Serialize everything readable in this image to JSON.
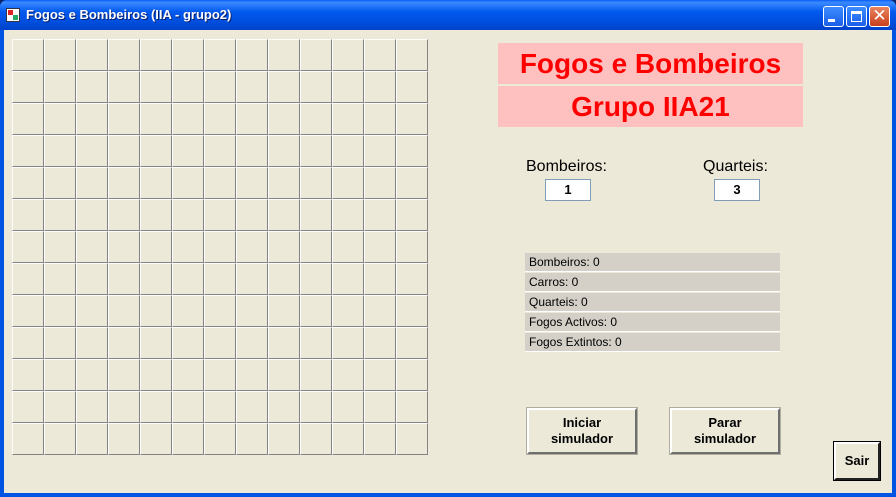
{
  "window": {
    "title": "Fogos e Bombeiros (IIA - grupo2)"
  },
  "grid": {
    "rows": 13,
    "columns": 13
  },
  "banner": {
    "line1": "Fogos e Bombeiros",
    "line2": "Grupo IIA21",
    "background": "#ffc0c0",
    "text_color": "#ff0000"
  },
  "inputs": {
    "bombeiros": {
      "label": "Bombeiros:",
      "value": "1"
    },
    "quarteis": {
      "label": "Quarteis:",
      "value": "3"
    }
  },
  "stats": [
    "Bombeiros: 0",
    "Carros: 0",
    "Quarteis: 0",
    "Fogos Activos: 0",
    "Fogos Extintos: 0"
  ],
  "buttons": {
    "start": {
      "line1": "Iniciar",
      "line2": "simulador"
    },
    "stop": {
      "line1": "Parar",
      "line2": "simulador"
    },
    "exit": "Sair"
  },
  "icons": {
    "app": "app-icon",
    "minimize": "minimize-icon",
    "maximize": "maximize-icon",
    "close": "close-icon"
  }
}
